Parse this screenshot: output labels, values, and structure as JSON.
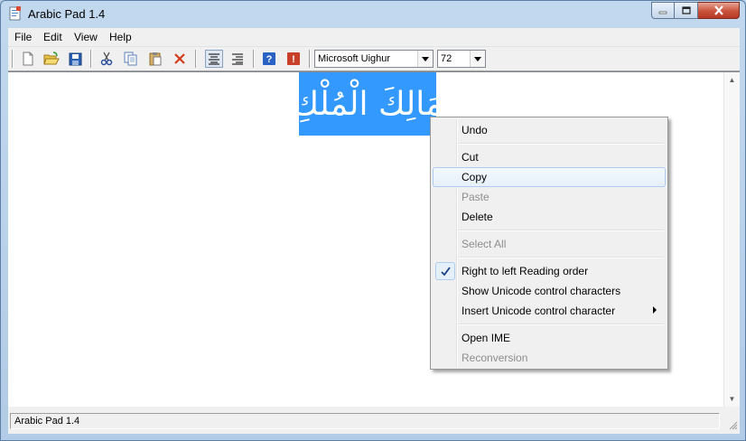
{
  "window": {
    "title": "Arabic Pad 1.4"
  },
  "menubar": {
    "file": "File",
    "edit": "Edit",
    "view": "View",
    "help": "Help"
  },
  "toolbar": {
    "font": "Microsoft Uighur",
    "size": "72"
  },
  "editor": {
    "selected_text": "مَالِكَ الْمُلْكِ"
  },
  "status": {
    "text": "Arabic Pad 1.4"
  },
  "context_menu": {
    "undo": "Undo",
    "cut": "Cut",
    "copy": "Copy",
    "paste": "Paste",
    "delete": "Delete",
    "select_all": "Select All",
    "rtl": "Right to left Reading order",
    "show_unicode": "Show Unicode control characters",
    "insert_unicode": "Insert Unicode control character",
    "open_ime": "Open IME",
    "reconversion": "Reconversion"
  }
}
